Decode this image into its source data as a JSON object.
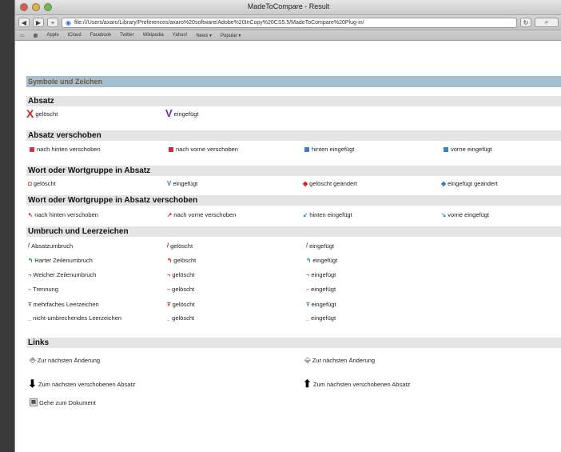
{
  "window": {
    "title": "MadeToCompare - Result",
    "url": "file:///Users/axaro/Library/Preferences/axaro%20software/Adobe%20InCopy%20CS5.5/MadeToCompare%20Plug-in/",
    "bookmarks": [
      "Apple",
      "iCloud",
      "Facebook",
      "Twitter",
      "Wikipedia",
      "Yahoo!",
      "News ▾",
      "Popular ▾"
    ]
  },
  "doc": {
    "title": "Symbole und Zeichen",
    "sections": {
      "absatz": "Absatz",
      "absatz_verschoben": "Absatz verschoben",
      "wort": "Wort oder Wortgruppe in Absatz",
      "wort_verschoben": "Wort oder Wortgruppe in Absatz verschoben",
      "umbruch": "Umbruch und Leerzeichen",
      "links": "Links"
    },
    "absatz": {
      "deleted": "gelöscht",
      "inserted": "eingefügt"
    },
    "absatz_verschoben": {
      "back": "nach hinten verschoben",
      "forward": "nach vorne verschoben",
      "back_inserted": "hinten eingefügt",
      "front_inserted": "vorne eingefügt"
    },
    "wort": {
      "deleted": "gelöscht",
      "inserted": "eingefügt",
      "deleted_changed": "gelöscht geändert",
      "inserted_changed": "eingefügt geändert"
    },
    "wort_verschoben": {
      "back": "nach hinten verschoben",
      "forward": "nach vorne verschoben",
      "back_inserted": "hinten eingefügt",
      "front_inserted": "vorne eingefügt"
    },
    "umbruch": {
      "rows": [
        {
          "label": "Absatzumbruch",
          "deleted": "gelöscht",
          "inserted": "eingefügt"
        },
        {
          "label": "Harter Zeilenumbruch",
          "deleted": "gelöscht",
          "inserted": "eingefügt"
        },
        {
          "label": "Weicher Zeilenumbruch",
          "deleted": "gelöscht",
          "inserted": "eingefügt"
        },
        {
          "label": "Trennung",
          "deleted": "gelöscht",
          "inserted": "eingefügt"
        },
        {
          "label": "mehrfaches Leerzeichen",
          "deleted": "gelöscht",
          "inserted": "eingefügt"
        },
        {
          "label": "nicht-umbrechendes Leerzeichen",
          "deleted": "gelöscht",
          "inserted": "eingefügt"
        }
      ]
    },
    "links": {
      "next_change_1": "Zur nächsten Änderung",
      "next_change_2": "Zur nächsten Änderung",
      "next_moved_1": "Zum nächsten verschobenen Absatz",
      "next_moved_2": "Zum nächsten verschobenen Absatz",
      "goto_document": "Gehe zum Dokument"
    }
  }
}
